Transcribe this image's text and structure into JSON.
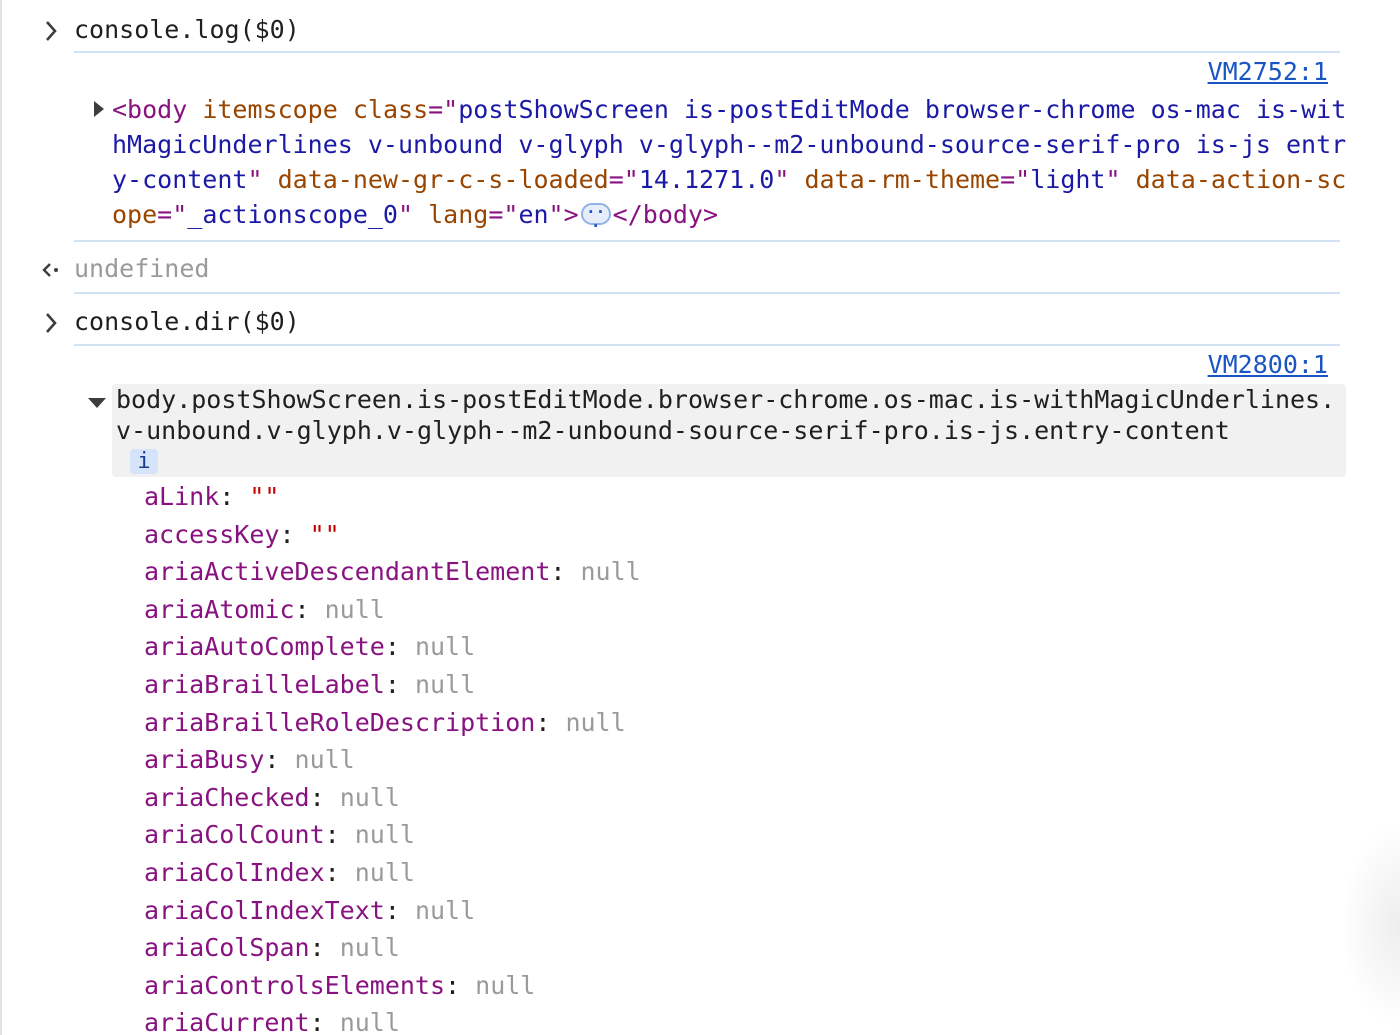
{
  "entries": [
    {
      "kind": "command",
      "text": "console.log($0)"
    },
    {
      "kind": "log",
      "source": "VM2752:1"
    },
    {
      "kind": "result",
      "text": "undefined"
    },
    {
      "kind": "command",
      "text": "console.dir($0)"
    },
    {
      "kind": "dir",
      "source": "VM2800:1"
    }
  ],
  "log_node": {
    "open_tag": "<body",
    "attrs": [
      {
        "name": "itemscope",
        "value": null
      },
      {
        "name": "class",
        "value": "postShowScreen is-postEditMode browser-chrome os-mac is-withMagicUnderlines v-unbound v-glyph v-glyph--m2-unbound-source-serif-pro is-js entry-content"
      },
      {
        "name": "data-new-gr-c-s-loaded",
        "value": "14.1271.0"
      },
      {
        "name": "data-rm-theme",
        "value": "light"
      },
      {
        "name": "data-action-scope",
        "value": "_actionscope_0"
      },
      {
        "name": "lang",
        "value": "en"
      }
    ],
    "close_open": ">",
    "ellipsis": "…",
    "close_tag": "</body>"
  },
  "dir_object": {
    "header": "body.postShowScreen.is-postEditMode.browser-chrome.os-mac.is-withMagicUnderlines.v-unbound.v-glyph.v-glyph--m2-unbound-source-serif-pro.is-js.entry-content",
    "info_badge": "i",
    "properties": [
      {
        "key": "aLink",
        "value": "\"\"",
        "type": "string"
      },
      {
        "key": "accessKey",
        "value": "\"\"",
        "type": "string"
      },
      {
        "key": "ariaActiveDescendantElement",
        "value": "null",
        "type": "null"
      },
      {
        "key": "ariaAtomic",
        "value": "null",
        "type": "null"
      },
      {
        "key": "ariaAutoComplete",
        "value": "null",
        "type": "null"
      },
      {
        "key": "ariaBrailleLabel",
        "value": "null",
        "type": "null"
      },
      {
        "key": "ariaBrailleRoleDescription",
        "value": "null",
        "type": "null"
      },
      {
        "key": "ariaBusy",
        "value": "null",
        "type": "null"
      },
      {
        "key": "ariaChecked",
        "value": "null",
        "type": "null"
      },
      {
        "key": "ariaColCount",
        "value": "null",
        "type": "null"
      },
      {
        "key": "ariaColIndex",
        "value": "null",
        "type": "null"
      },
      {
        "key": "ariaColIndexText",
        "value": "null",
        "type": "null"
      },
      {
        "key": "ariaColSpan",
        "value": "null",
        "type": "null"
      },
      {
        "key": "ariaControlsElements",
        "value": "null",
        "type": "null"
      },
      {
        "key": "ariaCurrent",
        "value": "null",
        "type": "null"
      }
    ]
  },
  "colors": {
    "tag": "#881280",
    "attr_name": "#994500",
    "attr_value": "#1a1aa6",
    "string_value": "#c80000",
    "null_value": "#9a9a9a",
    "link": "#1a55c4",
    "separator": "#d3e3f6"
  },
  "icons": {
    "command_prompt": "chevron-right-icon",
    "result_prompt": "return-arrow-icon",
    "expand_collapsed": "triangle-right-icon",
    "expand_open": "triangle-down-icon"
  }
}
